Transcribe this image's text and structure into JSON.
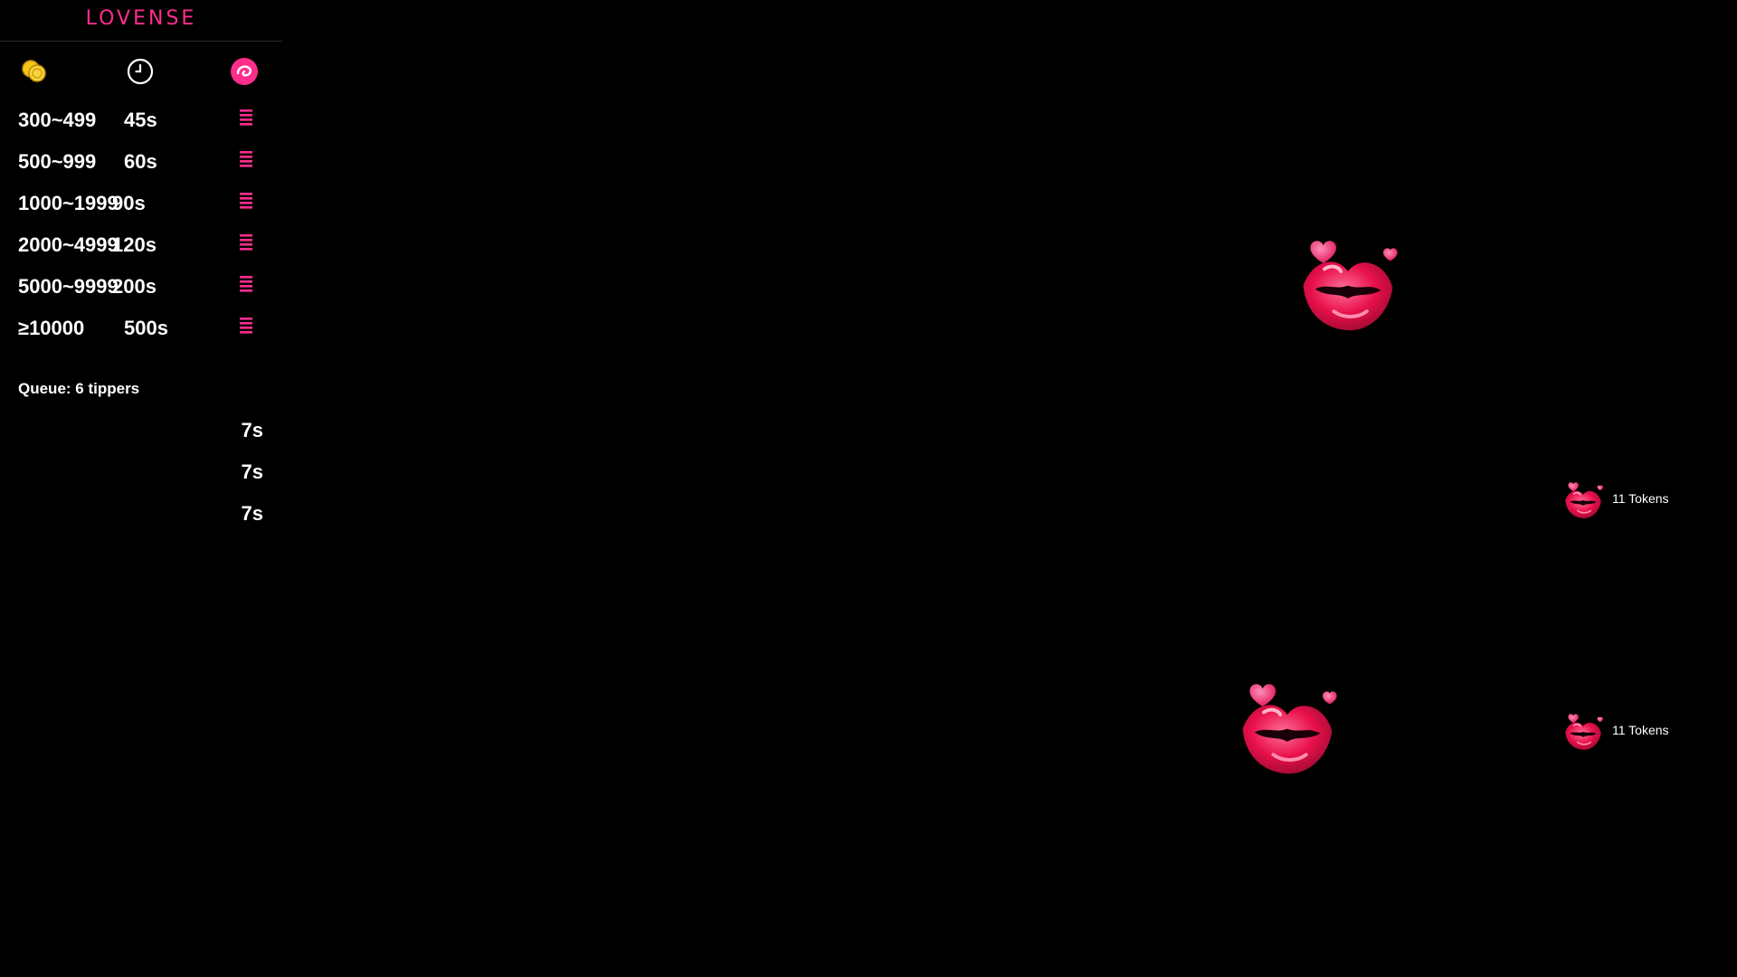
{
  "brand": {
    "logo_text": "LOVENSE"
  },
  "header_icons": [
    "coin-icon",
    "clock-icon",
    "lovense-toy-icon"
  ],
  "levels": [
    {
      "range": "300~499",
      "duration": "45s"
    },
    {
      "range": "500~999",
      "duration": "60s"
    },
    {
      "range": "1000~1999",
      "duration": "90s"
    },
    {
      "range": "2000~4999",
      "duration": "120s"
    },
    {
      "range": "5000~9999",
      "duration": "200s"
    },
    {
      "range": "≥10000",
      "duration": "500s"
    }
  ],
  "queue": {
    "label": "Queue: 6 tippers",
    "items": [
      "7s",
      "7s",
      "7s"
    ]
  },
  "tip_notifications": [
    {
      "text": "11 Tokens"
    },
    {
      "text": "11 Tokens"
    }
  ],
  "colors": {
    "background": "#000000",
    "accent": "#ff2d8c",
    "coin": "#f5c518",
    "lips": "#e8104a"
  }
}
